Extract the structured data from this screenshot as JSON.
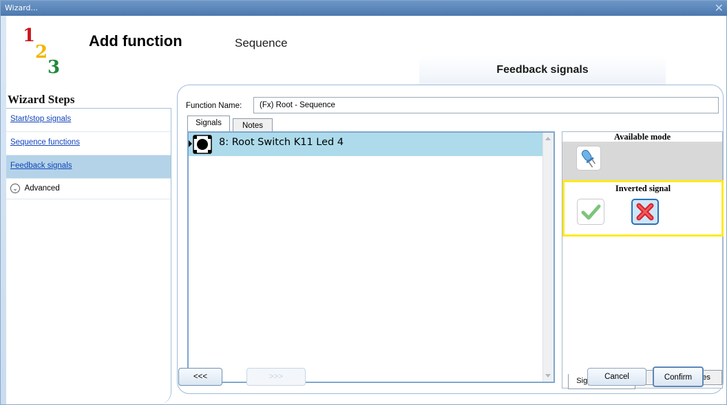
{
  "window": {
    "title": "Wizard...",
    "close_glyph": "✕"
  },
  "header": {
    "logo_digits": [
      "1",
      "2",
      "3"
    ],
    "logo_colors": [
      "#c8161d",
      "#f2b600",
      "#1f8a3a"
    ],
    "title": "Add function",
    "subtitle": "Sequence",
    "current_step": "Feedback signals"
  },
  "sidebar": {
    "title": "Wizard Steps",
    "items": [
      {
        "label": "Start/stop signals",
        "active": false
      },
      {
        "label": "Sequence functions",
        "active": false
      },
      {
        "label": "Feedback signals",
        "active": true
      }
    ],
    "advanced_label": "Advanced",
    "advanced_icon": "chevron-down-icon"
  },
  "form": {
    "function_name_label": "Function Name:",
    "function_name_value": "(Fx) Root - Sequence"
  },
  "tabs": [
    "Signals",
    "Notes"
  ],
  "signals_list": [
    {
      "label": "8: Root Switch K11 Led 4",
      "icon": "switch-led-icon",
      "selected": true
    }
  ],
  "settings": {
    "available_mode_title": "Available mode",
    "mode_icon": "led-bulb-icon",
    "inverted_title": "Inverted signal",
    "inverted_options": [
      {
        "icon": "check-icon",
        "selected": false
      },
      {
        "icon": "cross-icon",
        "selected": true
      }
    ],
    "bottom_tabs": [
      "Signal Settings",
      "Signal Properties"
    ],
    "highlight_color": "#ffea1a"
  },
  "buttons": {
    "back": "<<<",
    "next": ">>>",
    "cancel": "Cancel",
    "confirm": "Confirm"
  }
}
